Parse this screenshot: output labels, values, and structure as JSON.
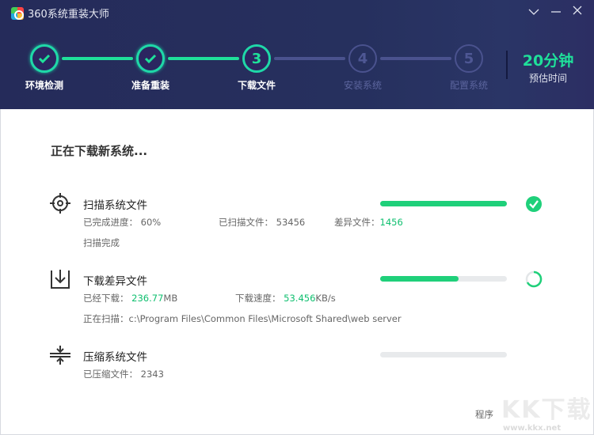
{
  "window": {
    "title": "360系统重装大师"
  },
  "steps": [
    {
      "num": "1",
      "label": "环境检测",
      "state": "done"
    },
    {
      "num": "2",
      "label": "准备重装",
      "state": "done"
    },
    {
      "num": "3",
      "label": "下载文件",
      "state": "current"
    },
    {
      "num": "4",
      "label": "安装系统",
      "state": "todo"
    },
    {
      "num": "5",
      "label": "配置系统",
      "state": "todo"
    }
  ],
  "eta": {
    "value": "20分钟",
    "label": "预估时间"
  },
  "main": {
    "heading": "正在下载新系统...",
    "tasks": [
      {
        "name": "扫描系统文件",
        "progress": 1.0,
        "status": "complete",
        "progress_label": "已完成进度：",
        "progress_value": "60%",
        "scanned_label": "已扫描文件：",
        "scanned_value": "53456",
        "diff_label": "差异文件：",
        "diff_value": "1456",
        "note": "扫描完成"
      },
      {
        "name": "下载差异文件",
        "progress": 0.62,
        "status": "loading",
        "downloaded_label": "已经下载：",
        "downloaded_value": "236.77",
        "downloaded_unit": "MB",
        "speed_label": "下载速度：",
        "speed_value": "53.456",
        "speed_unit": "KB/s",
        "scanning_label": "正在扫描：",
        "scanning_path": "c:\\Program Files\\Common Files\\Microsoft Shared\\web server"
      },
      {
        "name": "压缩系统文件",
        "progress": 0,
        "status": "pending",
        "compressed_label": "已压缩文件：",
        "compressed_value": "2343"
      }
    ]
  },
  "footer": {
    "text": "程序"
  },
  "watermark": {
    "logo": "KK下载",
    "url": "www.kkx.net"
  },
  "colors": {
    "accent": "#1fe09a",
    "bar": "#1fd07a",
    "header": "#252b5a"
  }
}
